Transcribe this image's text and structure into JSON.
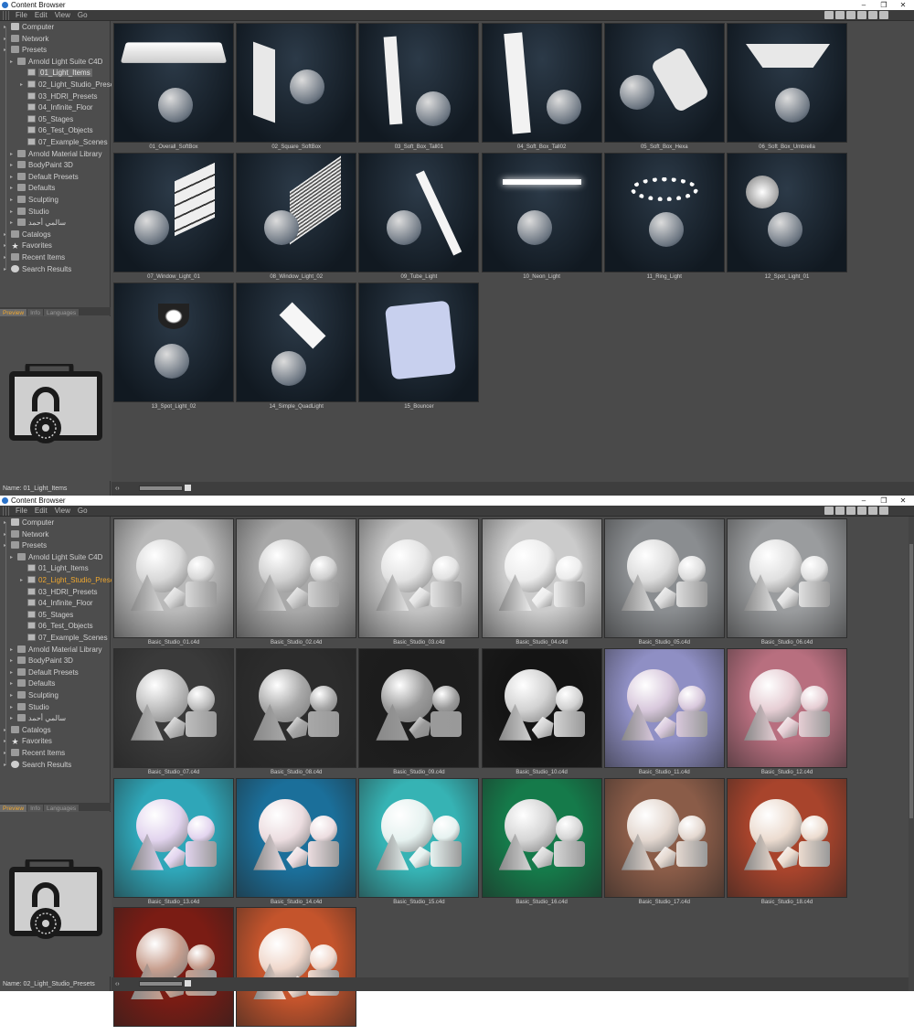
{
  "windows": [
    {
      "title": "Content Browser",
      "menu": [
        "File",
        "Edit",
        "View",
        "Go"
      ],
      "tree": [
        {
          "label": "Computer",
          "level": 0,
          "icon": "computer-icon"
        },
        {
          "label": "Network",
          "level": 0,
          "icon": "network-icon"
        },
        {
          "label": "Presets",
          "level": 0,
          "icon": "presets-icon"
        },
        {
          "label": "Arnold Light Suite C4D",
          "level": 1,
          "icon": "folder-icon"
        },
        {
          "label": "01_Light_Items",
          "level": 2,
          "icon": "folder-icon",
          "selected": true
        },
        {
          "label": "02_Light_Studio_Presets",
          "level": 2,
          "icon": "folder-icon"
        },
        {
          "label": "03_HDRI_Presets",
          "level": 2,
          "icon": "folder-icon"
        },
        {
          "label": "04_Infinite_Floor",
          "level": 2,
          "icon": "folder-icon"
        },
        {
          "label": "05_Stages",
          "level": 2,
          "icon": "folder-icon"
        },
        {
          "label": "06_Test_Objects",
          "level": 2,
          "icon": "folder-icon"
        },
        {
          "label": "07_Example_Scenes",
          "level": 2,
          "icon": "folder-icon"
        },
        {
          "label": "Arnold Material Library",
          "level": 1,
          "icon": "folder-icon"
        },
        {
          "label": "BodyPaint 3D",
          "level": 1,
          "icon": "folder-icon"
        },
        {
          "label": "Default Presets",
          "level": 1,
          "icon": "folder-icon"
        },
        {
          "label": "Defaults",
          "level": 1,
          "icon": "folder-icon"
        },
        {
          "label": "Sculpting",
          "level": 1,
          "icon": "folder-icon"
        },
        {
          "label": "Studio",
          "level": 1,
          "icon": "folder-icon"
        },
        {
          "label": "سالمي أحمد",
          "level": 1,
          "icon": "folder-icon"
        },
        {
          "label": "Catalogs",
          "level": 0,
          "icon": "catalogs-icon"
        },
        {
          "label": "Favorites",
          "level": 0,
          "icon": "star-icon"
        },
        {
          "label": "Recent Items",
          "level": 0,
          "icon": "recent-icon"
        },
        {
          "label": "Search Results",
          "level": 0,
          "icon": "search-icon"
        }
      ],
      "tabs": [
        "Preview",
        "Info",
        "Languages"
      ],
      "name_label": "Name: 01_Light_Items",
      "items": [
        {
          "label": "01_Overall_SoftBox",
          "look": "dark"
        },
        {
          "label": "02_Square_SoftBox",
          "look": "dark"
        },
        {
          "label": "03_Soft_Box_Tall01",
          "look": "dark"
        },
        {
          "label": "04_Soft_Box_Tall02",
          "look": "dark"
        },
        {
          "label": "05_Soft_Box_Hexa",
          "look": "dark"
        },
        {
          "label": "06_Soft_Box_Umbrella",
          "look": "dark"
        },
        {
          "label": "07_Window_Light_01",
          "look": "dark"
        },
        {
          "label": "08_Window_Light_02",
          "look": "dark"
        },
        {
          "label": "09_Tube_Light",
          "look": "dark"
        },
        {
          "label": "10_Neon_Light",
          "look": "dark"
        },
        {
          "label": "11_Ring_Light",
          "look": "dark"
        },
        {
          "label": "12_Spot_Light_01",
          "look": "dark"
        },
        {
          "label": "13_Spot_Light_02",
          "look": "dark"
        },
        {
          "label": "14_Simple_QuadLight",
          "look": "dark"
        },
        {
          "label": "15_Bouncer",
          "look": "dark"
        }
      ]
    },
    {
      "title": "Content Browser",
      "menu": [
        "File",
        "Edit",
        "View",
        "Go"
      ],
      "tree": [
        {
          "label": "Computer",
          "level": 0,
          "icon": "computer-icon"
        },
        {
          "label": "Network",
          "level": 0,
          "icon": "network-icon"
        },
        {
          "label": "Presets",
          "level": 0,
          "icon": "presets-icon"
        },
        {
          "label": "Arnold Light Suite C4D",
          "level": 1,
          "icon": "folder-icon"
        },
        {
          "label": "01_Light_Items",
          "level": 2,
          "icon": "folder-icon"
        },
        {
          "label": "02_Light_Studio_Presets",
          "level": 2,
          "icon": "folder-icon",
          "highlight": true
        },
        {
          "label": "03_HDRI_Presets",
          "level": 2,
          "icon": "folder-icon"
        },
        {
          "label": "04_Infinite_Floor",
          "level": 2,
          "icon": "folder-icon"
        },
        {
          "label": "05_Stages",
          "level": 2,
          "icon": "folder-icon"
        },
        {
          "label": "06_Test_Objects",
          "level": 2,
          "icon": "folder-icon"
        },
        {
          "label": "07_Example_Scenes",
          "level": 2,
          "icon": "folder-icon"
        },
        {
          "label": "Arnold Material Library",
          "level": 1,
          "icon": "folder-icon"
        },
        {
          "label": "BodyPaint 3D",
          "level": 1,
          "icon": "folder-icon"
        },
        {
          "label": "Default Presets",
          "level": 1,
          "icon": "folder-icon"
        },
        {
          "label": "Defaults",
          "level": 1,
          "icon": "folder-icon"
        },
        {
          "label": "Sculpting",
          "level": 1,
          "icon": "folder-icon"
        },
        {
          "label": "Studio",
          "level": 1,
          "icon": "folder-icon"
        },
        {
          "label": "سالمي أحمد",
          "level": 1,
          "icon": "folder-icon"
        },
        {
          "label": "Catalogs",
          "level": 0,
          "icon": "catalogs-icon"
        },
        {
          "label": "Favorites",
          "level": 0,
          "icon": "star-icon"
        },
        {
          "label": "Recent Items",
          "level": 0,
          "icon": "recent-icon"
        },
        {
          "label": "Search Results",
          "level": 0,
          "icon": "search-icon"
        }
      ],
      "tabs": [
        "Preview",
        "Info",
        "Languages"
      ],
      "name_label": "Name: 02_Light_Studio_Presets",
      "items": [
        {
          "label": "Basic_Studio_01.c4d",
          "bg": "#b9b9b9",
          "obj": "#d8d8d8"
        },
        {
          "label": "Basic_Studio_02.c4d",
          "bg": "#a8a8a8",
          "obj": "#cfcfcf"
        },
        {
          "label": "Basic_Studio_03.c4d",
          "bg": "#c2c2c2",
          "obj": "#e2e2e2"
        },
        {
          "label": "Basic_Studio_04.c4d",
          "bg": "#cbcbcb",
          "obj": "#ececec"
        },
        {
          "label": "Basic_Studio_05.c4d",
          "bg": "#8a8d90",
          "obj": "#dcdcdc"
        },
        {
          "label": "Basic_Studio_06.c4d",
          "bg": "#9a9c9e",
          "obj": "#e0e0e0"
        },
        {
          "label": "Basic_Studio_07.c4d",
          "bg": "#3a3a3a",
          "obj": "#bdbdbd"
        },
        {
          "label": "Basic_Studio_08.c4d",
          "bg": "#2c2c2c",
          "obj": "#a8a8a8"
        },
        {
          "label": "Basic_Studio_09.c4d",
          "bg": "#1c1c1c",
          "obj": "#9a9a9a"
        },
        {
          "label": "Basic_Studio_10.c4d",
          "bg": "#141414",
          "obj": "#d2d2d2"
        },
        {
          "label": "Basic_Studio_11.c4d",
          "bg": "#8f8fc4",
          "obj": "#d8c8dc"
        },
        {
          "label": "Basic_Studio_12.c4d",
          "bg": "#b86f7f",
          "obj": "#e6ced4"
        },
        {
          "label": "Basic_Studio_13.c4d",
          "bg": "#2fa6b8",
          "obj": "#e2d4ee"
        },
        {
          "label": "Basic_Studio_14.c4d",
          "bg": "#1b6f9a",
          "obj": "#ecdde0"
        },
        {
          "label": "Basic_Studio_15.c4d",
          "bg": "#36b3b4",
          "obj": "#e6f2f0"
        },
        {
          "label": "Basic_Studio_16.c4d",
          "bg": "#157a4a",
          "obj": "#d6d6d6"
        },
        {
          "label": "Basic_Studio_17.c4d",
          "bg": "#8a5c48",
          "obj": "#e4d8d0"
        },
        {
          "label": "Basic_Studio_18.c4d",
          "bg": "#a8442c",
          "obj": "#ecdcd0"
        },
        {
          "label": "",
          "bg": "#7a1c14",
          "obj": "#c8a090"
        },
        {
          "label": "",
          "bg": "#c4542c",
          "obj": "#f0d8cc"
        }
      ]
    }
  ],
  "window_controls": [
    "–",
    "❐",
    "✕"
  ],
  "zoom_icon": "‹›"
}
